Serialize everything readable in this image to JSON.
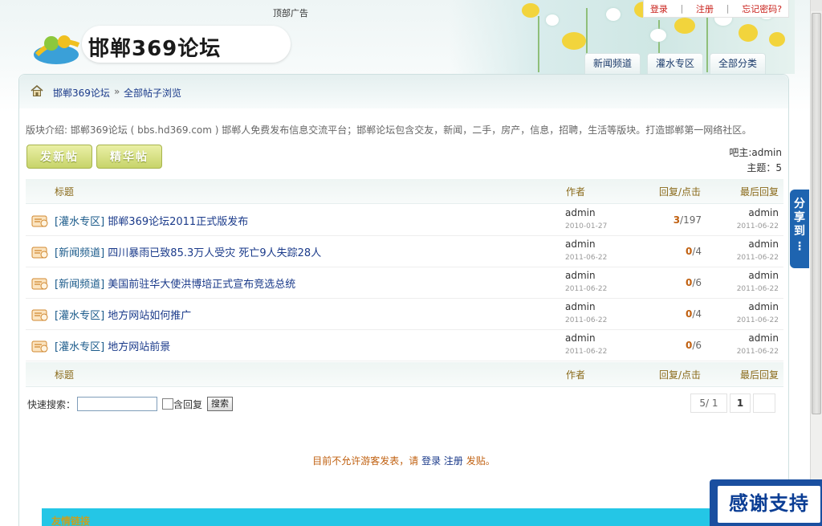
{
  "header": {
    "top_ad": "顶部广告",
    "user_links": {
      "login": "登录",
      "register": "注册",
      "forgot": "忘记密码?"
    },
    "logo_text": "邯郸369论坛",
    "nav_tabs": [
      "新闻频道",
      "灌水专区",
      "全部分类"
    ]
  },
  "breadcrumb": {
    "home": "邯郸369论坛",
    "separator": "»",
    "current": "全部帖子浏览"
  },
  "board": {
    "intro": "版块介绍: 邯郸369论坛 ( bbs.hd369.com ) 邯郸人免费发布信息交流平台；邯郸论坛包含交友，新闻，二手，房产，信息，招聘，生活等版块。打造邯郸第一网络社区。",
    "buttons": {
      "new_post": "发新帖",
      "elite": "精华帖"
    },
    "owner": "吧主:admin",
    "topics": "主题：5"
  },
  "table": {
    "columns": {
      "title": "标题",
      "author": "作者",
      "reply_click": "回复/点击",
      "last_reply": "最后回复"
    },
    "rows": [
      {
        "category": "[灌水专区]",
        "title": "邯郸369论坛2011正式版发布",
        "author": "admin",
        "author_date": "2010-01-27",
        "replies": "3",
        "clicks": "/197",
        "last_user": "admin",
        "last_date": "2011-06-22"
      },
      {
        "category": "[新闻频道]",
        "title": "四川暴雨已致85.3万人受灾 死亡9人失踪28人",
        "author": "admin",
        "author_date": "2011-06-22",
        "replies": "0",
        "clicks": "/4",
        "last_user": "admin",
        "last_date": "2011-06-22"
      },
      {
        "category": "[新闻频道]",
        "title": "美国前驻华大使洪博培正式宣布竞选总统",
        "author": "admin",
        "author_date": "2011-06-22",
        "replies": "0",
        "clicks": "/6",
        "last_user": "admin",
        "last_date": "2011-06-22"
      },
      {
        "category": "[灌水专区]",
        "title": "地方网站如何推广",
        "author": "admin",
        "author_date": "2011-06-22",
        "replies": "0",
        "clicks": "/4",
        "last_user": "admin",
        "last_date": "2011-06-22"
      },
      {
        "category": "[灌水专区]",
        "title": "地方网站前景",
        "author": "admin",
        "author_date": "2011-06-22",
        "replies": "0",
        "clicks": "/6",
        "last_user": "admin",
        "last_date": "2011-06-22"
      }
    ]
  },
  "search": {
    "label": "快速搜索：",
    "include_reply": "含回复",
    "button": "搜索"
  },
  "pager": {
    "count": "5/ 1",
    "current": "1"
  },
  "notice": {
    "prefix": "目前不允许游客发表，请",
    "login": "登录",
    "register": "注册",
    "suffix": "发贴。"
  },
  "links": {
    "title": "友情链接"
  },
  "share_tab": {
    "line1": "分",
    "line2": "享",
    "line3": "到",
    "dots": "⋮"
  },
  "thanks": "感谢支持"
}
